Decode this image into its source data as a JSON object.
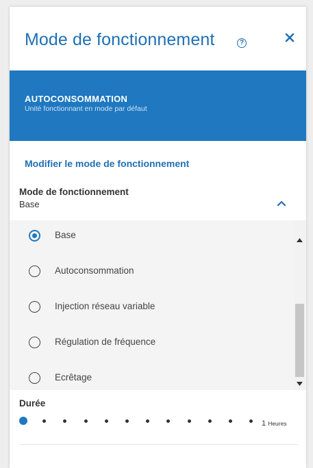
{
  "header": {
    "title": "Mode de fonctionnement",
    "help_icon": "help-circle-icon",
    "help_glyph": "?",
    "close_icon": "close-icon"
  },
  "banner": {
    "title": "AUTOCONSOMMATION",
    "subtitle": "Unité fonctionnant en mode par défaut",
    "color": "#1f78c0"
  },
  "modify_link": "Modifier le mode de fonctionnement",
  "mode_field": {
    "label": "Mode de fonctionnement",
    "value": "Base",
    "options": [
      {
        "label": "Base",
        "checked": true
      },
      {
        "label": "Autoconsommation",
        "checked": false
      },
      {
        "label": "Injection réseau variable",
        "checked": false
      },
      {
        "label": "Régulation de fréquence",
        "checked": false
      },
      {
        "label": "Ecrêtage",
        "checked": false
      }
    ]
  },
  "duration": {
    "label": "Durée",
    "value": "1",
    "unit": "Heures",
    "steps": 12,
    "selected_step": 1
  },
  "colors": {
    "accent": "#1f6fb3",
    "banner": "#1f78c0",
    "dropdown_bg": "#f4f4f4"
  }
}
